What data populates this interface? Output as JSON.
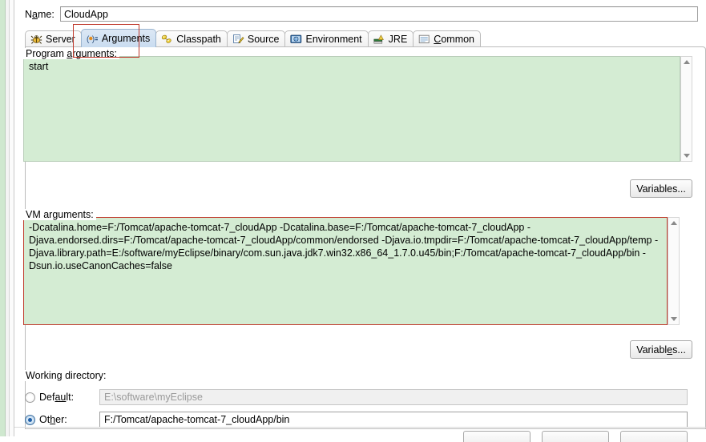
{
  "name_row": {
    "label_prefix": "N",
    "label_underlined": "a",
    "label_suffix": "me:",
    "value": "CloudApp",
    "placeholder": ""
  },
  "tabs": [
    {
      "id": "server",
      "label": "Server",
      "icon": "bug-icon",
      "selected": false,
      "mnemonic": ""
    },
    {
      "id": "arguments",
      "label": "Arguments",
      "icon": "arguments-icon",
      "selected": true,
      "mnemonic": ""
    },
    {
      "id": "classpath",
      "label": "Classpath",
      "icon": "classpath-icon",
      "selected": false,
      "mnemonic": ""
    },
    {
      "id": "source",
      "label": "Source",
      "icon": "source-icon",
      "selected": false,
      "mnemonic": ""
    },
    {
      "id": "environment",
      "label": "Environment",
      "icon": "environment-icon",
      "selected": false,
      "mnemonic": ""
    },
    {
      "id": "jre",
      "label": "JRE",
      "icon": "jre-icon",
      "selected": false,
      "mnemonic": ""
    },
    {
      "id": "common",
      "label": "Common",
      "icon": "common-icon",
      "selected": false,
      "mnemonic": "C"
    }
  ],
  "program_arguments": {
    "label_prefix": "Program ",
    "label_mnemonic": "a",
    "label_suffix": "rguments:",
    "value": "start",
    "variables_button": {
      "prefix": "Variables...",
      "mnemonic": "",
      "suffix": ""
    }
  },
  "vm_arguments": {
    "label": "VM arguments:",
    "value": "-Dcatalina.home=F:/Tomcat/apache-tomcat-7_cloudApp -Dcatalina.base=F:/Tomcat/apache-tomcat-7_cloudApp -Djava.endorsed.dirs=F:/Tomcat/apache-tomcat-7_cloudApp/common/endorsed -Djava.io.tmpdir=F:/Tomcat/apache-tomcat-7_cloudApp/temp -Djava.library.path=E:/software/myEclipse/binary/com.sun.java.jdk7.win32.x86_64_1.7.0.u45/bin;F:/Tomcat/apache-tomcat-7_cloudApp/bin -Dsun.io.useCanonCaches=false",
    "variables_button": {
      "prefix": "Variabl",
      "mnemonic": "e",
      "suffix": "s..."
    }
  },
  "working_directory": {
    "label": "Working directory:",
    "default_option": {
      "prefix": "Def",
      "mnemonic": "au",
      "suffix": "lt:",
      "selected": false,
      "value": "E:\\software\\myEclipse"
    },
    "other_option": {
      "prefix": "Ot",
      "mnemonic": "h",
      "suffix": "er:",
      "selected": true,
      "value": "F:/Tomcat/apache-tomcat-7_cloudApp/bin"
    }
  },
  "annotations": {
    "tab_highlight_color": "#c0392b",
    "vm_highlight_color": "#c0392b"
  },
  "colors": {
    "textarea_background": "#d4ecd3",
    "selected_tab": "#c9dcf0",
    "window_background": "#ffffff"
  },
  "scrollbars": {
    "up_arrow": "scroll-up-arrow",
    "down_arrow": "scroll-down-arrow"
  }
}
